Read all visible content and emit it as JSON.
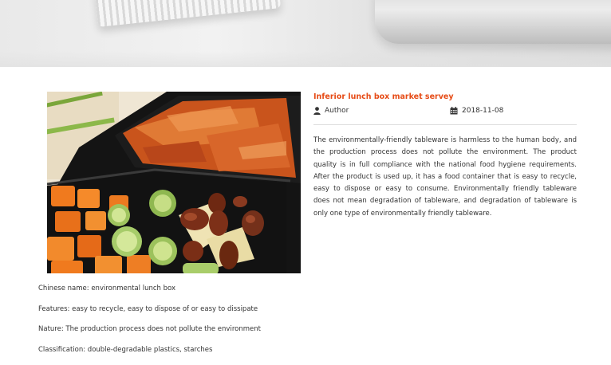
{
  "article": {
    "title": "Inferior lunch box market servey",
    "author": "Author",
    "date": "2018-11-08",
    "body": "The environmentally-friendly tableware is harmless to the human body, and the production process does not pollute the environment. The product quality is in full compliance with the national food hygiene requirements. After the product is used up, it has a food container that is easy to recycle, easy to dispose or easy to consume. Environmentally friendly tableware does not mean degradation of tableware, and degradation of tableware is only one type of environmentally friendly tableware."
  },
  "specs": [
    "Chinese name: environmental lunch box",
    "Features: easy to recycle, easy to dispose of or easy to dissipate",
    "Nature: The production process does not pollute the environment",
    "Classification: double-degradable plastics, starches"
  ],
  "colors": {
    "accent": "#e64b16",
    "text": "#333333",
    "divider": "#dcdcdc"
  },
  "icons": {
    "author": "user-icon",
    "date": "calendar-icon"
  }
}
